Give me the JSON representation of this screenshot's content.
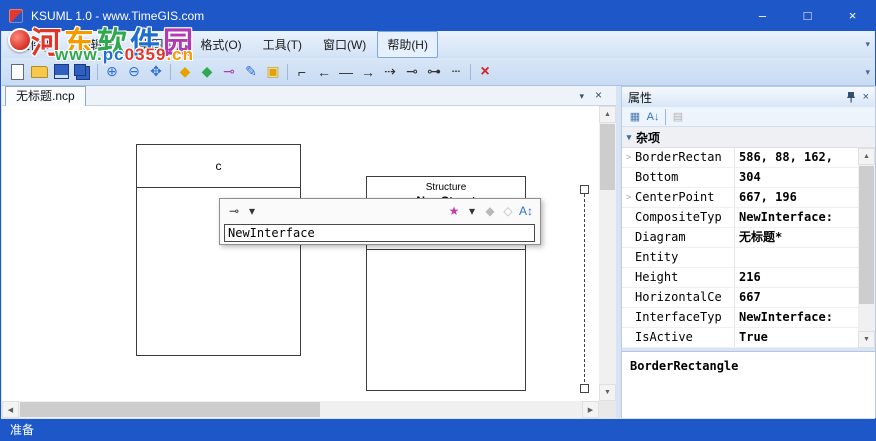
{
  "colors": {
    "titlebar": "#1d57c8",
    "chrome": "#d6e4f6",
    "accent": "#2f6fd0"
  },
  "glyphs": {
    "dropdown": "▾",
    "close": "×",
    "up": "▲",
    "down": "▼",
    "left": "◀",
    "right": "▶"
  },
  "window": {
    "title": "KSUML 1.0 - www.TimeGIS.com",
    "minimize": "–",
    "maximize": "□",
    "close": "×"
  },
  "watermark": {
    "line1": [
      {
        "t": "河",
        "c": "#e0362a"
      },
      {
        "t": "东",
        "c": "#f59b00"
      },
      {
        "t": "软",
        "c": "#2fa84f"
      },
      {
        "t": "件",
        "c": "#1f6fd0"
      },
      {
        "t": "园",
        "c": "#b03ab0"
      }
    ],
    "line2": [
      {
        "t": "www.",
        "c": "#2fa84f"
      },
      {
        "t": "pc",
        "c": "#1f6fd0"
      },
      {
        "t": "0359",
        "c": "#e0362a"
      },
      {
        "t": ".cn",
        "c": "#f59b00"
      }
    ]
  },
  "menu": {
    "items": [
      {
        "label": "文件(F)",
        "state": ""
      },
      {
        "label": "编辑(E)",
        "state": ""
      },
      {
        "label": "类图(V)",
        "state": ""
      },
      {
        "label": "格式(O)",
        "state": ""
      },
      {
        "label": "工具(T)",
        "state": ""
      },
      {
        "label": "窗口(W)",
        "state": ""
      },
      {
        "label": "帮助(H)",
        "state": "active"
      }
    ]
  },
  "toolbar": {
    "items": [
      {
        "name": "new-button",
        "cls": "ic-page",
        "glyph": ""
      },
      {
        "name": "open-button",
        "cls": "ic-folder",
        "glyph": ""
      },
      {
        "name": "save-button",
        "cls": "ic-floppy",
        "glyph": ""
      },
      {
        "name": "save-all-button",
        "cls": "ic-floppy2",
        "glyph": ""
      },
      {
        "name": "separator",
        "cls": "ic-sep",
        "glyph": ""
      },
      {
        "name": "zoom-in-button",
        "glyph": "⊕",
        "color": "#2f6fd0"
      },
      {
        "name": "zoom-out-button",
        "glyph": "⊖",
        "color": "#2f6fd0"
      },
      {
        "name": "zoom-fit-button",
        "glyph": "✥",
        "color": "#2f6fd0"
      },
      {
        "name": "separator",
        "cls": "ic-sep",
        "glyph": ""
      },
      {
        "name": "shape-button",
        "glyph": "◆",
        "color": "#e3a400"
      },
      {
        "name": "shape-green-button",
        "glyph": "◆",
        "color": "#2fa84f"
      },
      {
        "name": "connector-button",
        "glyph": "⊸",
        "color": "#b03ab0"
      },
      {
        "name": "edit-button",
        "glyph": "✎",
        "color": "#2f6fd0"
      },
      {
        "name": "note-button",
        "glyph": "▣",
        "color": "#e3a400"
      },
      {
        "name": "separator",
        "cls": "ic-sep",
        "glyph": ""
      },
      {
        "name": "elbow-connector-button",
        "glyph": "⌐",
        "color": "#333333"
      },
      {
        "name": "arrow-left-button",
        "glyph": "←",
        "color": "#333333"
      },
      {
        "name": "line-button",
        "glyph": "—",
        "color": "#333333"
      },
      {
        "name": "arrow-right-button",
        "glyph": "→",
        "color": "#333333"
      },
      {
        "name": "dashed-arrow-button",
        "glyph": "⇢",
        "color": "#333333"
      },
      {
        "name": "circle-end-line-button",
        "glyph": "⊸",
        "color": "#333333"
      },
      {
        "name": "circle-start-line-button",
        "glyph": "⊶",
        "color": "#333333"
      },
      {
        "name": "dashed-line-button",
        "glyph": "┄",
        "color": "#333333"
      },
      {
        "name": "separator",
        "cls": "ic-sep",
        "glyph": ""
      },
      {
        "name": "delete-button",
        "cls": "ic-del",
        "glyph": "×",
        "color": "#d42222"
      }
    ]
  },
  "tabs": {
    "active_tab": "无标题.ncp"
  },
  "canvas": {
    "class_box": {
      "name": "c"
    },
    "struct_box": {
      "stereotype": "Structure",
      "name": "NewStruct"
    },
    "popup": {
      "value": "NewInterface",
      "left_icons": [
        {
          "name": "connector-icon",
          "glyph": "⊸",
          "color": "#333333"
        },
        {
          "name": "dropdown-icon",
          "glyph": "▾",
          "color": "#333333"
        }
      ],
      "right_icons": [
        {
          "name": "add-member-icon",
          "glyph": "★",
          "color": "#c837ab"
        },
        {
          "name": "dropdown-icon",
          "glyph": "▾",
          "color": "#333333"
        },
        {
          "name": "member-icon",
          "glyph": "◆",
          "color": "#b8b8b8"
        },
        {
          "name": "member-alt-icon",
          "glyph": "◇",
          "color": "#b8b8b8"
        },
        {
          "name": "sort-icon",
          "glyph": "A↕",
          "color": "#2f6fd0"
        }
      ]
    }
  },
  "properties": {
    "title": "属性",
    "toolbar": [
      {
        "name": "categorized-button",
        "glyph": "▦",
        "color": "#4a7ab5"
      },
      {
        "name": "alphabetical-button",
        "glyph": "A↓",
        "color": "#2f6fd0"
      },
      {
        "name": "separator",
        "cls": "ic-sep",
        "glyph": ""
      },
      {
        "name": "property-pages-button",
        "glyph": "▤",
        "color": "#b0b0b0"
      }
    ],
    "category": "杂项",
    "rows": [
      {
        "expander": ">",
        "name": "BorderRectan",
        "value": "586, 88, 162,"
      },
      {
        "expander": "",
        "name": "Bottom",
        "value": "304"
      },
      {
        "expander": ">",
        "name": "CenterPoint",
        "value": "667, 196"
      },
      {
        "expander": "",
        "name": "CompositeTyp",
        "value": "NewInterface:"
      },
      {
        "expander": "",
        "name": "Diagram",
        "value": "无标题*"
      },
      {
        "expander": "",
        "name": "Entity",
        "value": ""
      },
      {
        "expander": "",
        "name": "Height",
        "value": "216"
      },
      {
        "expander": "",
        "name": "HorizontalCe",
        "value": "667"
      },
      {
        "expander": "",
        "name": "InterfaceTyp",
        "value": "NewInterface:"
      },
      {
        "expander": "",
        "name": "IsActive",
        "value": "True"
      }
    ],
    "description_title": "BorderRectangle"
  },
  "statusbar": {
    "text": "准备"
  }
}
